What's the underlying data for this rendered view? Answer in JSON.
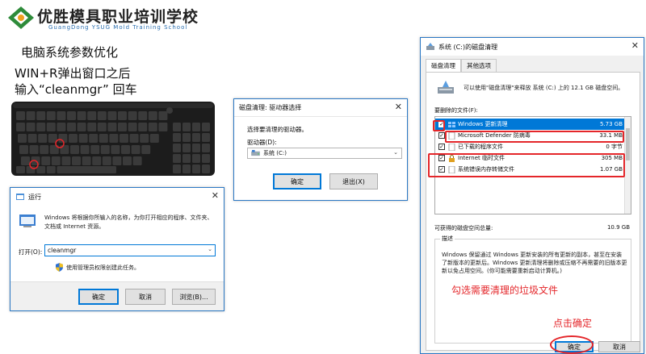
{
  "header": {
    "brand_name": "优胜模具职业培训学校",
    "brand_subtitle": "GuangDong YSUG Mold Training School",
    "brand_color": "#2e8b3a",
    "heading": "电脑系统参数优化",
    "step_line1": "WIN+R弹出窗口之后",
    "step_line2": "输入“cleanmgr” 回车"
  },
  "run_dialog": {
    "title": "运行",
    "description": "Windows 将根据你所输入的名称，为你打开相应的程序、文件夹、文档或 Internet 资源。",
    "open_label": "打开(O):",
    "open_value": "cleanmgr",
    "admin_note": "使用管理员权限创建此任务。",
    "ok_label": "确定",
    "cancel_label": "取消",
    "browse_label": "浏览(B)..."
  },
  "drive_dialog": {
    "title": "磁盘清理: 驱动器选择",
    "prompt": "选择要清理的驱动器。",
    "drive_label": "驱动器(D):",
    "drive_value": "系统 (C:)",
    "ok_label": "确定",
    "exit_label": "退出(X)"
  },
  "cleanup_dialog": {
    "title": "系统 (C:)的磁盘清理",
    "tabs": [
      "磁盘清理",
      "其他选项"
    ],
    "intro": "可以使用\"磁盘清理\"来释放 系统 (C:) 上的 12.1 GB 磁盘空间。",
    "files_label": "要删除的文件(F):",
    "files": [
      {
        "name": "Windows 更新清理",
        "size": "5.73 GB",
        "checked": true,
        "selected": true
      },
      {
        "name": "Microsoft Defender 防病毒",
        "size": "33.1 MB",
        "checked": true,
        "selected": false
      },
      {
        "name": "已下载的程序文件",
        "size": "0 字节",
        "checked": true,
        "selected": false
      },
      {
        "name": "Internet 临时文件",
        "size": "305 MB",
        "checked": true,
        "selected": false
      },
      {
        "name": "系统错误内存转储文件",
        "size": "1.07 GB",
        "checked": true,
        "selected": false
      }
    ],
    "total_label": "可获得的磁盘空间总量:",
    "total_value": "10.9 GB",
    "desc_title": "描述",
    "desc_text": "Windows 保留通过 Windows 更新安装的所有更新的副本，甚至在安装了新版本的更新后。Windows 更新清理将删除或压缩不再需要的旧版本更新以免占用空间。(你可能需要重新启动计算机。)",
    "ok_label": "确定",
    "cancel_label": "取消"
  },
  "annotations": {
    "select_note": "勾选需要清理的垃圾文件",
    "click_ok_note": "点击确定",
    "highlight_color": "#e4262a"
  }
}
